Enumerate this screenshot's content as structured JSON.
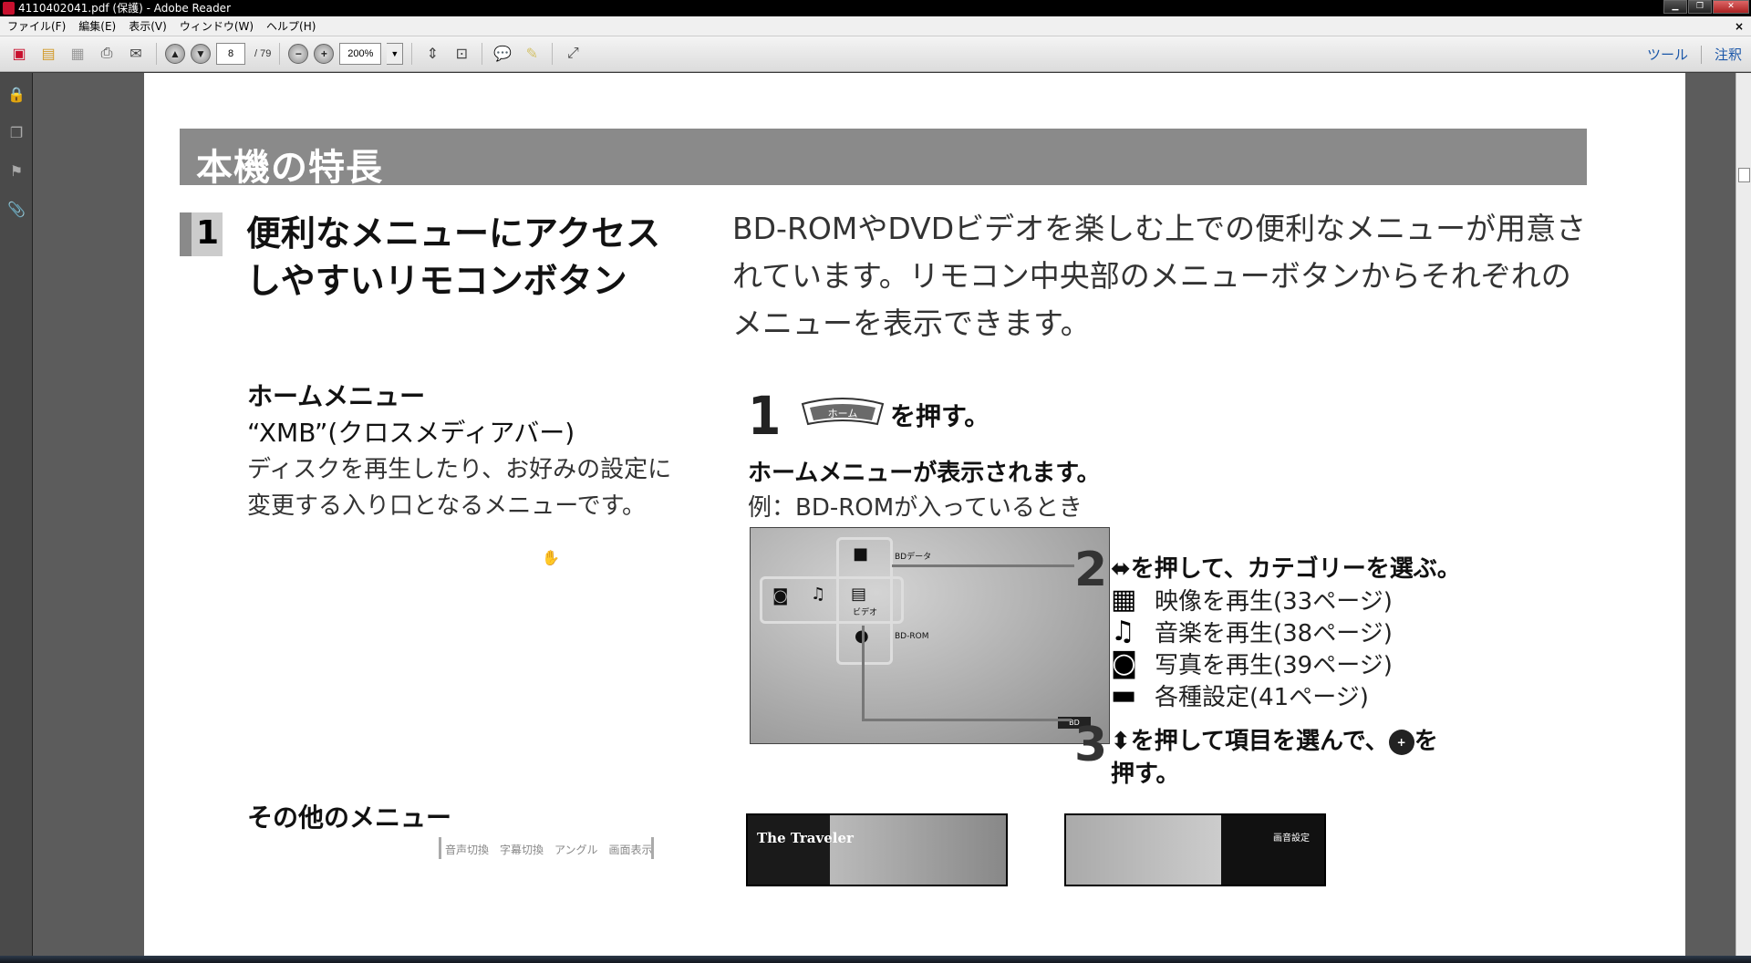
{
  "window": {
    "title": "4110402041.pdf (保護) - Adobe Reader"
  },
  "menu": {
    "items": [
      "ファイル(F)",
      "編集(E)",
      "表示(V)",
      "ウィンドウ(W)",
      "ヘルプ(H)"
    ],
    "close": "×"
  },
  "toolbar": {
    "page_current": "8",
    "page_total": "/ 79",
    "zoom": "200%",
    "tools_label": "ツール",
    "comment_label": "注釈"
  },
  "page": {
    "section_title": "本機の特長",
    "feature_number": "1",
    "feature_title": "便利なメニューにアクセスしやすいリモコンボタン",
    "intro": "BD-ROMやDVDビデオを楽しむ上での便利なメニューが用意されています。リモコン中央部のメニューボタンからそれぞれのメニューを表示できます。",
    "home_menu_title": "ホームメニュー",
    "xmb_label": "“XMB”(クロスメディアバー)",
    "home_menu_desc": "ディスクを再生したり、お好みの設定に変更する入り口となるメニューです。",
    "step1_number": "1",
    "home_button_label": "ホーム",
    "step1_text": "を押す。",
    "step1_sub": "ホームメニューが表示されます。",
    "step1_example": "例：BD-ROMが入っているとき",
    "screen": {
      "bd_data_label": "BDデータ",
      "video_label": "ビデオ",
      "bdrom_label": "BD-ROM",
      "bd_logo": "BD"
    },
    "step2_number": "2",
    "step2_text": "を押して、カテゴリーを選ぶ。",
    "categories": [
      {
        "icon": "film-icon",
        "label": "映像を再生(33ページ)"
      },
      {
        "icon": "music-icon",
        "label": "音楽を再生(38ページ)"
      },
      {
        "icon": "camera-icon",
        "label": "写真を再生(39ページ)"
      },
      {
        "icon": "toolbox-icon",
        "label": "各種設定(41ページ)"
      }
    ],
    "step3_number": "3",
    "step3_text_a": "を押して項目を選んで、",
    "step3_text_b": "を押す。",
    "other_menu_title": "その他のメニュー",
    "osd_labels": "音声切換　字幕切換　アングル　画面表示",
    "thumb1_title": "The Traveler",
    "thumb2_label": "画音設定"
  }
}
